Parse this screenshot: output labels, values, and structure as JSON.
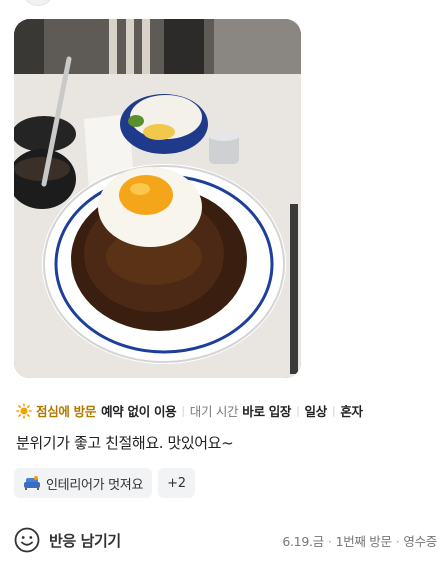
{
  "review": {
    "photo_alt": "",
    "tags": {
      "lunch": "점심에 방문",
      "no_reservation": "예약 없이 이용",
      "wait_label": "대기 시간",
      "wait_value": "바로 입장",
      "purpose": "일상",
      "companion": "혼자"
    },
    "text": "분위기가 좋고 친절해요. 맛있어요~",
    "keywords": {
      "first": "인테리어가 멋져요",
      "more": "+2"
    },
    "footer": {
      "react_label": "반응 남기기",
      "date": "6.19.금",
      "visit": "1번째 방문",
      "proof": "영수증"
    }
  },
  "icons": {
    "sun": "sun-icon",
    "sofa": "sofa-icon",
    "smile": "smile-icon"
  },
  "colors": {
    "lunch_accent": "#b07a00",
    "chip_bg": "#f2f3f5"
  }
}
